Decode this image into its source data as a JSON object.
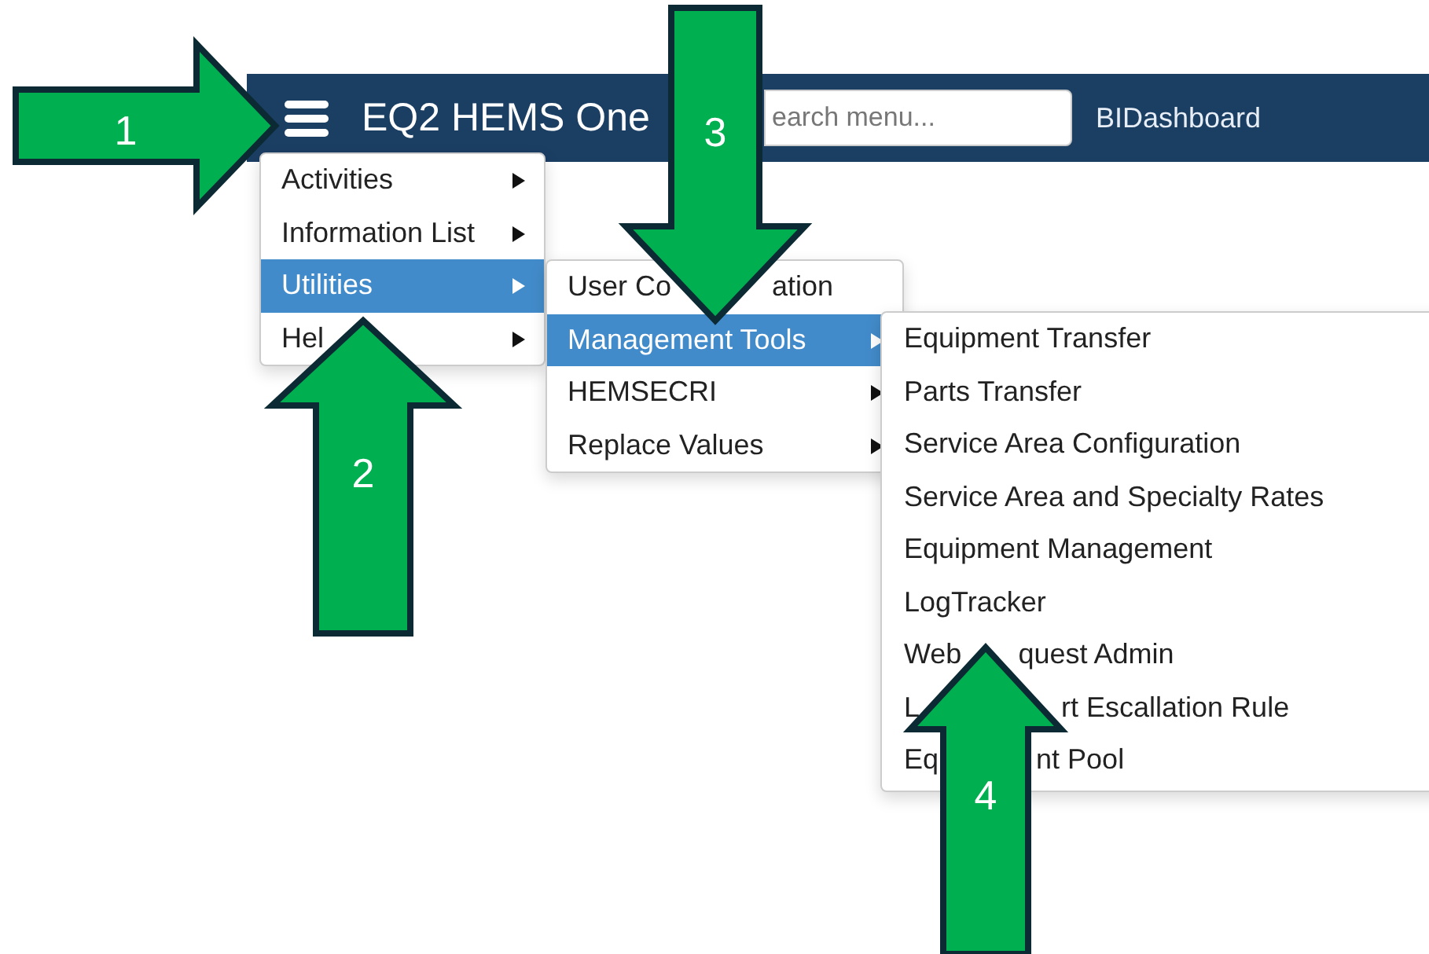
{
  "navbar": {
    "title": "EQ2 HEMS One",
    "search": {
      "placeholder": "earch menu..."
    },
    "link": "BIDashboard"
  },
  "menus": [
    {
      "items": [
        {
          "parts": [
            "Activities"
          ],
          "has_submenu": true,
          "selected": false
        },
        {
          "parts": [
            "Information List"
          ],
          "has_submenu": true,
          "selected": false
        },
        {
          "parts": [
            "Utilities"
          ],
          "has_submenu": true,
          "selected": true
        },
        {
          "parts": [
            "Hel"
          ],
          "has_submenu": true,
          "selected": false
        }
      ]
    },
    {
      "items": [
        {
          "parts": [
            "User Co",
            "ation"
          ],
          "has_submenu": false,
          "selected": false
        },
        {
          "parts": [
            "Management Tools"
          ],
          "has_submenu": true,
          "selected": true
        },
        {
          "parts": [
            "HEMSECRI"
          ],
          "has_submenu": true,
          "selected": false
        },
        {
          "parts": [
            "Replace Values"
          ],
          "has_submenu": true,
          "selected": false
        }
      ]
    },
    {
      "items": [
        {
          "parts": [
            "Equipment Transfer"
          ],
          "has_submenu": false,
          "selected": false
        },
        {
          "parts": [
            "Parts Transfer"
          ],
          "has_submenu": false,
          "selected": false
        },
        {
          "parts": [
            "Service Area Configuration"
          ],
          "has_submenu": false,
          "selected": false
        },
        {
          "parts": [
            "Service Area and Specialty Rates"
          ],
          "has_submenu": false,
          "selected": false
        },
        {
          "parts": [
            "Equipment Management"
          ],
          "has_submenu": false,
          "selected": false
        },
        {
          "parts": [
            "LogTracker"
          ],
          "has_submenu": false,
          "selected": false
        },
        {
          "parts": [
            "Web",
            "quest Admin"
          ],
          "has_submenu": false,
          "selected": false
        },
        {
          "parts": [
            "L",
            "rt Escallation Rule"
          ],
          "has_submenu": false,
          "selected": false
        },
        {
          "parts": [
            "Eq",
            "nt Pool"
          ],
          "has_submenu": false,
          "selected": false
        }
      ]
    }
  ],
  "callouts": [
    {
      "number": "1",
      "kind": "right"
    },
    {
      "number": "2",
      "kind": "up"
    },
    {
      "number": "3",
      "kind": "down"
    },
    {
      "number": "4",
      "kind": "up"
    }
  ]
}
